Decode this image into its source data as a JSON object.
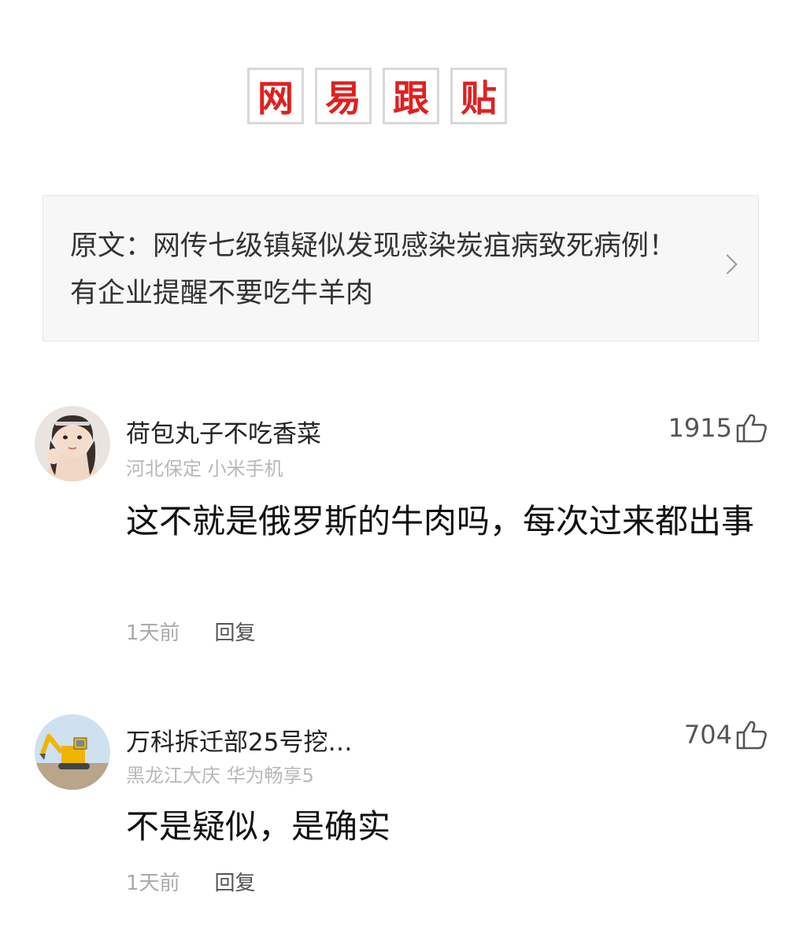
{
  "logo": {
    "chars": [
      "网",
      "易",
      "跟",
      "贴"
    ],
    "color": "#e02020"
  },
  "article": {
    "prefix": "原文：",
    "title": "网传七级镇疑似发现感染炭疽病致死病例！有企业提醒不要吃牛羊肉",
    "icon": "chevron-right-icon"
  },
  "comments": [
    {
      "username": "荷包丸子不吃香菜",
      "location": "河北保定",
      "device": "小米手机",
      "likes": "1915",
      "text": "这不就是俄罗斯的牛肉吗，每次过来都出事",
      "time": "1天前",
      "reply_label": "回复",
      "avatar": "girl-portrait-avatar"
    },
    {
      "username": "万科拆迁部25号挖…",
      "location": "黑龙江大庆",
      "device": "华为畅享5",
      "likes": "704",
      "text": "不是疑似，是确实",
      "time": "1天前",
      "reply_label": "回复",
      "avatar": "excavator-avatar"
    }
  ]
}
